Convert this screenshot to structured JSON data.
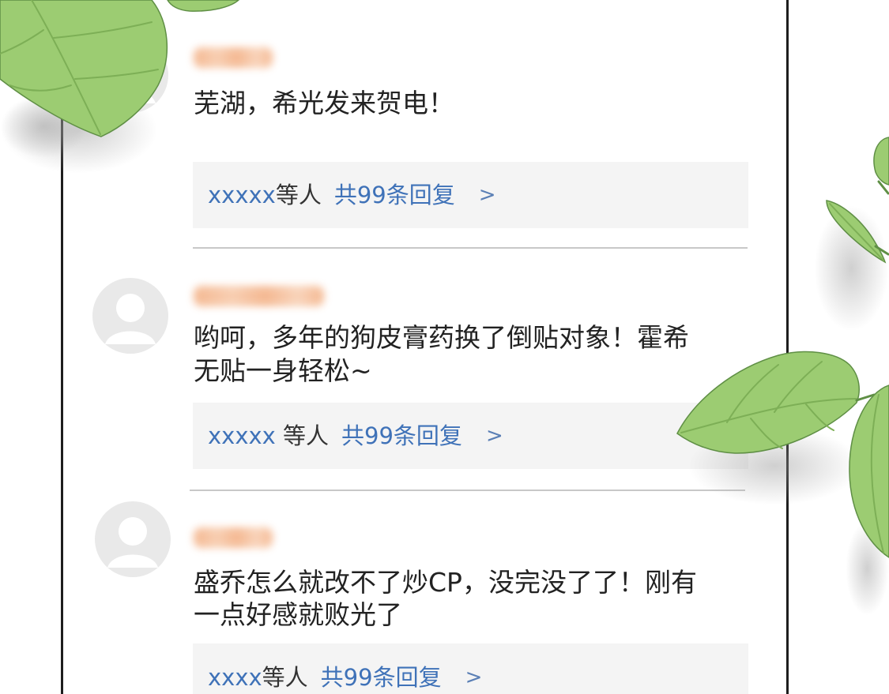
{
  "comments": [
    {
      "lines": [
        "芜湖，希光发来贺电！"
      ],
      "reply": {
        "users": "xxxxx",
        "others": "等人",
        "count": "共99条回复",
        "arrow": ">"
      }
    },
    {
      "lines": [
        "哟呵，多年的狗皮膏药换了倒贴对象！霍希",
        "无贴一身轻松~"
      ],
      "reply": {
        "users": "xxxxx",
        "others": " 等人",
        "count": "共99条回复",
        "arrow": ">"
      }
    },
    {
      "lines": [
        "盛乔怎么就改不了炒CP，没完没了了！刚有",
        "一点好感就败光了"
      ],
      "reply": {
        "users": "xxxx",
        "others": "等人",
        "count": "共99条回复",
        "arrow": ">"
      }
    }
  ],
  "colors": {
    "link_blue": "#3f72b8",
    "text": "#222222",
    "reply_bg": "#f4f4f4",
    "divider": "#c8c8c8",
    "username_blur": "#f3ad80",
    "leaf_green": "#9ccc72",
    "avatar_bg": "#e9e9e9"
  },
  "icons": {
    "avatar": "default-avatar-icon",
    "reply_arrow": "chevron-right",
    "decoration": "leaf"
  }
}
